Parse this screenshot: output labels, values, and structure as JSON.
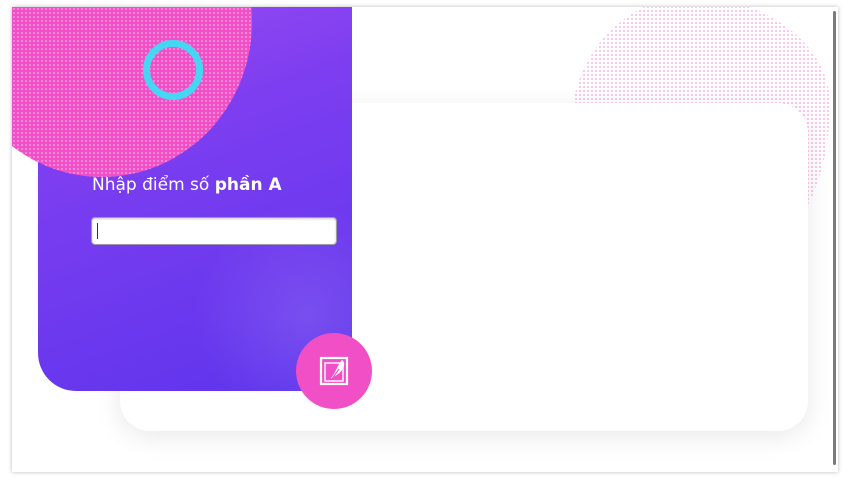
{
  "form": {
    "label_prefix": "Nhập điểm số ",
    "label_emphasis": "phần A",
    "input_value": ""
  },
  "actions": {
    "submit_icon": "edit-note-icon"
  },
  "colors": {
    "accent_purple": "#7d3ef0",
    "accent_pink": "#f04fc6",
    "accent_cyan": "#44d6f2"
  }
}
